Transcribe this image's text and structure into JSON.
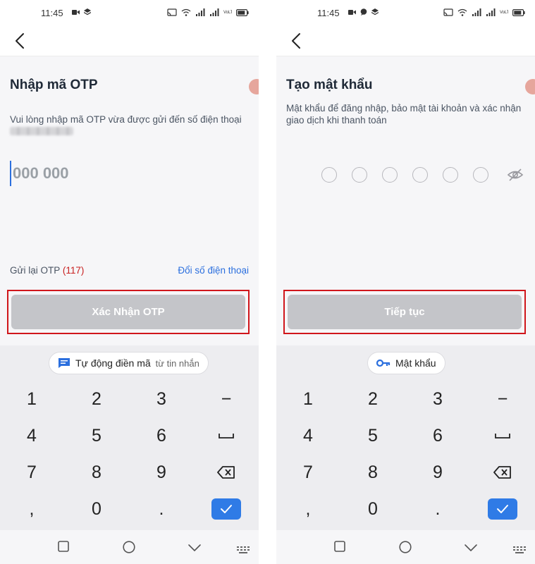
{
  "status_bar": {
    "time": "11:45",
    "network_label": "VoLTE"
  },
  "colors": {
    "accent": "#2b6fde",
    "disabled_button": "#c4c5c9",
    "highlight_border": "#d0161b",
    "countdown": "#c81e1e",
    "enter_key": "#2f7be6"
  },
  "otp_screen": {
    "title": "Nhập mã OTP",
    "description": "Vui lòng nhập mã OTP vừa được gửi đến số điện thoại",
    "otp_placeholder": "000 000",
    "resend_label": "Gửi lại OTP",
    "resend_countdown": "(117)",
    "change_phone_link": "Đổi số điện thoại",
    "confirm_button": "Xác Nhận OTP",
    "keyboard_chip": {
      "main": "Tự động điền mã",
      "sub": "từ tin nhắn",
      "icon": "message-icon"
    }
  },
  "password_screen": {
    "title": "Tạo mật khẩu",
    "description": "Mật khẩu để đăng nhập, bảo mật tài khoản và xác nhận giao dịch khi thanh toán",
    "pin_length": 6,
    "continue_button": "Tiếp tục",
    "keyboard_chip": {
      "main": "Mật khẩu",
      "icon": "key-icon"
    }
  },
  "keyboard": {
    "keys": [
      "1",
      "2",
      "3",
      "−",
      "4",
      "5",
      "6",
      "␣",
      "7",
      "8",
      "9",
      "⌫",
      ",",
      "0",
      ".",
      "✓"
    ]
  },
  "nav_bar": {
    "icons": [
      "recent-apps-icon",
      "home-icon",
      "back-down-icon",
      "keyboard-icon"
    ]
  }
}
